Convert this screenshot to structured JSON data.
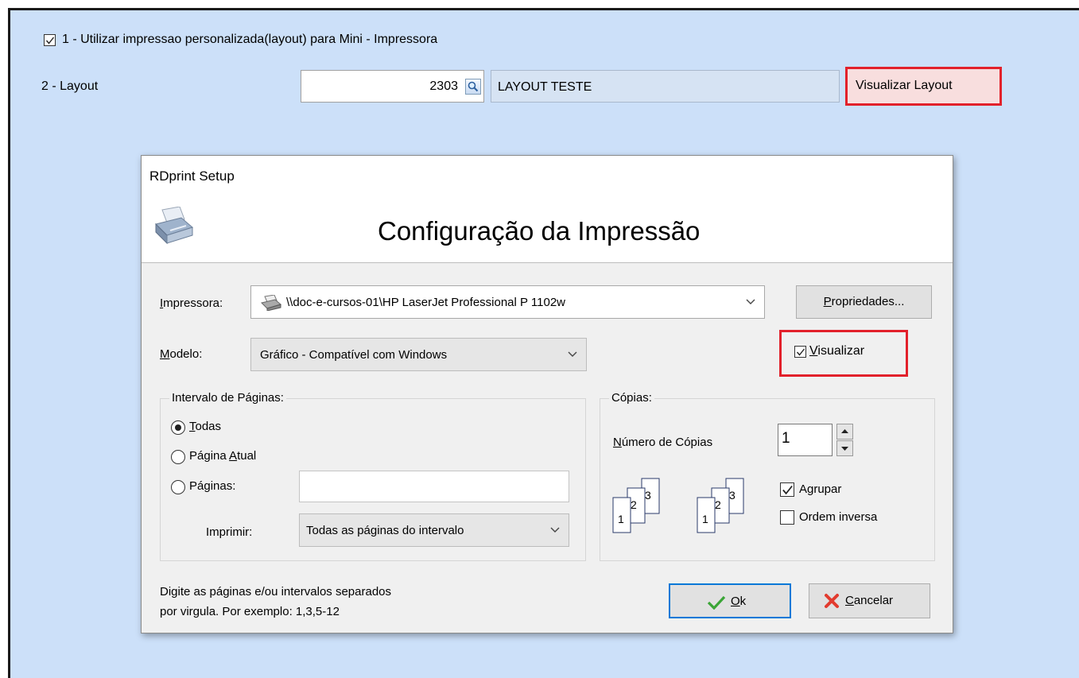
{
  "top": {
    "option1_label": "1 - Utilizar impressao personalizada(layout) para Mini - Impressora",
    "option1_checked": true,
    "layout_label": "2 - Layout",
    "layout_code": "2303",
    "layout_name": "LAYOUT TESTE",
    "view_layout_button": "Visualizar Layout"
  },
  "dialog": {
    "title": "RDprint Setup",
    "heading": "Configuração da Impressão",
    "printer": {
      "label_u": "I",
      "label_rest": "mpressora:",
      "value": "\\\\doc-e-cursos-01\\HP LaserJet Professional P 1102w",
      "properties_u": "P",
      "properties_rest": "ropriedades..."
    },
    "model": {
      "label_u": "M",
      "label_rest": "odelo:",
      "value": "Gráfico - Compatível com Windows"
    },
    "preview": {
      "label_u": "V",
      "label_rest": "isualizar",
      "checked": true
    },
    "page_range": {
      "title": "Intervalo de Páginas:",
      "all_u": "T",
      "all_rest": "odas",
      "current_a": "Página ",
      "current_u": "A",
      "current_b": "tual",
      "pages_a": "Pá",
      "pages_u": "g",
      "pages_b": "inas:",
      "pages_value": "",
      "print_label": "Imprimir:",
      "print_value": "Todas as páginas do intervalo"
    },
    "copies": {
      "title": "Cópias:",
      "count_u": "N",
      "count_rest": "úmero de Cópias",
      "count_value": "1",
      "collate_label": "Agrupar",
      "collate_checked": true,
      "reverse_label": "Ordem inversa",
      "reverse_checked": false,
      "page_numbers": [
        "1",
        "2",
        "3"
      ]
    },
    "hint_line1": "Digite as páginas e/ou intervalos separados",
    "hint_line2": "por virgula.  Por exemplo: 1,3,5-12",
    "ok_u": "O",
    "ok_rest": "k",
    "cancel_u": "C",
    "cancel_rest": "ancelar"
  }
}
